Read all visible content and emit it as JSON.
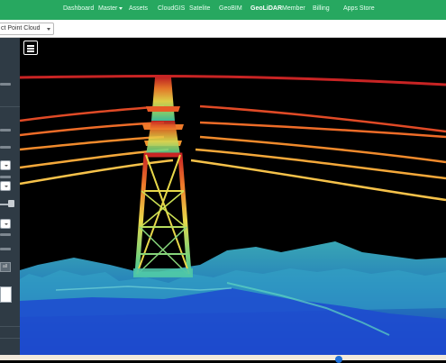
{
  "navbar": {
    "items": [
      {
        "label": "Dashboard"
      },
      {
        "label": "Master"
      },
      {
        "label": "Assets"
      },
      {
        "label": "CloudGIS"
      },
      {
        "label": "Satelite"
      },
      {
        "label": "GeoBIM"
      },
      {
        "label": "GeoLiDAR"
      },
      {
        "label": "Member"
      },
      {
        "label": "Billing"
      },
      {
        "label": "Apps Store"
      }
    ],
    "active": "GeoLiDAR",
    "background": "#27a860"
  },
  "toolbar": {
    "layer_select_value": "ct Point Cloud"
  },
  "sidebar": {
    "button_label": "all"
  },
  "viewer": {
    "type": "point-cloud",
    "subject": "transmission tower with power lines",
    "colormap": [
      "#1f4fd1",
      "#22b6c9",
      "#4fd27a",
      "#e8e040",
      "#ee8a2a",
      "#d42424"
    ],
    "background": "#000000"
  }
}
